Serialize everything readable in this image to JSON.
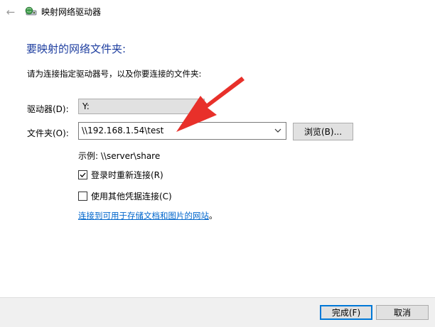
{
  "window": {
    "title": "映射网络驱动器",
    "back_icon": "back-arrow-icon",
    "app_icon": "network-drive-icon"
  },
  "main": {
    "heading": "要映射的网络文件夹:",
    "instruction": "请为连接指定驱动器号，以及你要连接的文件夹:",
    "drive_label": "驱动器(D):",
    "drive_value": "Y:",
    "folder_label": "文件夹(O):",
    "folder_value": "\\\\192.168.1.54\\test",
    "browse_label": "浏览(B)...",
    "example_text": "示例: \\\\server\\share",
    "reconnect_label": "登录时重新连接(R)",
    "reconnect_checked": true,
    "other_credentials_label": "使用其他凭据连接(C)",
    "other_credentials_checked": false,
    "link_text": "连接到可用于存储文档和图片的网站",
    "link_suffix": "。"
  },
  "footer": {
    "finish_label": "完成(F)",
    "cancel_label": "取消"
  },
  "colors": {
    "heading": "#1f3fa0",
    "link": "#0066cc",
    "annotation_arrow": "#e8302a"
  }
}
